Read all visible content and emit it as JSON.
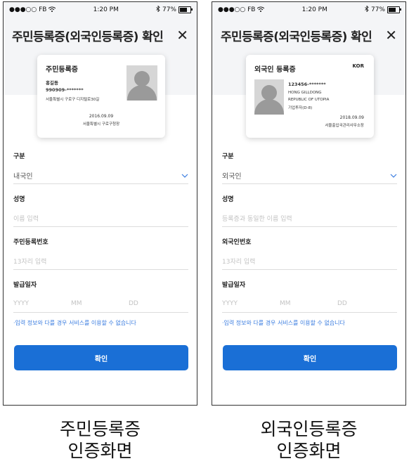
{
  "status_bar": {
    "carrier": "●●●○○ FB",
    "time": "1:20 PM",
    "battery": "77%"
  },
  "screens": [
    {
      "title": "주민등록증(외국인등록증) 확인",
      "card": {
        "title": "주민등록증",
        "kor": "",
        "name": "홍길동",
        "id_number": "990909-*******",
        "line1": "서울특별시 구로구 디지털로30길",
        "line2": "",
        "line3": "",
        "date": "2016.09.09",
        "issuer": "서울특별시 구로구청장"
      },
      "fields": {
        "type_label": "구분",
        "type_value": "내국인",
        "name_label": "성명",
        "name_placeholder": "이름 입력",
        "number_label": "주민등록번호",
        "number_placeholder": "13자리 입력",
        "date_label": "발급일자",
        "yyyy": "YYYY",
        "mm": "MM",
        "dd": "DD"
      },
      "notice": "·입력 정보와 다를 경우 서비스를 이용할 수 없습니다",
      "confirm": "확인",
      "caption_line1": "주민등록증",
      "caption_line2": "인증화면"
    },
    {
      "title": "주민등록증(외국인등록증) 확인",
      "card": {
        "title": "외국인 등록증",
        "kor": "KOR",
        "name": "",
        "id_number": "123456-*******",
        "line1": "HONG GILLDONG",
        "line2": "REPUBLIC OF UTOPIA",
        "line3": "기업투자(D-8)",
        "date": "2018.09.09",
        "issuer": "서울출입국관리사무소장"
      },
      "fields": {
        "type_label": "구분",
        "type_value": "외국인",
        "name_label": "성명",
        "name_placeholder": "등록증과 동일한 이름 입력",
        "number_label": "외국인번호",
        "number_placeholder": "13자리 입력",
        "date_label": "발급일자",
        "yyyy": "YYYY",
        "mm": "MM",
        "dd": "DD"
      },
      "notice": "·입력 정보와 다를 경우 서비스를 이용할 수 없습니다",
      "confirm": "확인",
      "caption_line1": "외국인등록증",
      "caption_line2": "인증화면"
    }
  ],
  "icons": {
    "wifi": "wifi-icon",
    "bluetooth": "bluetooth-icon",
    "battery": "battery-icon",
    "close": "close-icon",
    "chevron": "chevron-down-icon",
    "avatar": "person-silhouette-icon"
  },
  "colors": {
    "accent": "#1a6fd6",
    "link": "#3b7de0",
    "header_bg": "#f4f5f7"
  }
}
